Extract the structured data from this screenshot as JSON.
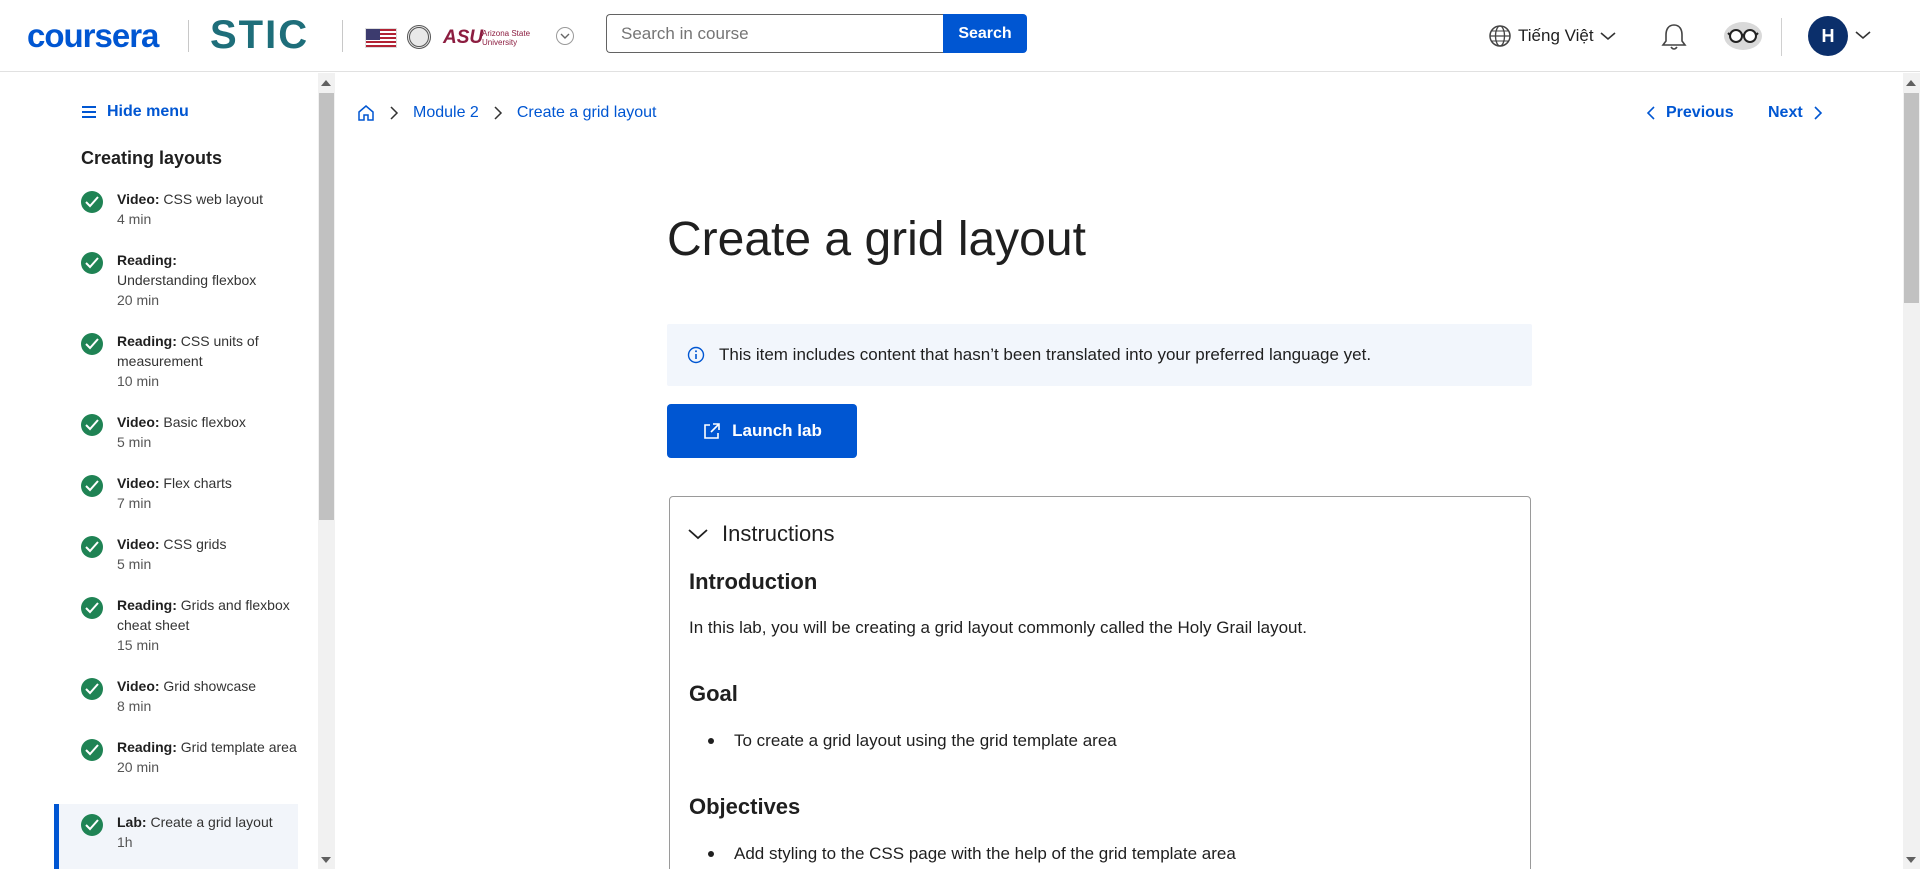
{
  "header": {
    "brand": "coursera",
    "partner": "STIC",
    "asu": "ASU",
    "asu_sub": "Arizona State University",
    "search_placeholder": "Search in course",
    "search_button": "Search",
    "language": "Tiếng Việt",
    "avatar_initial": "H"
  },
  "sidebar": {
    "hide_menu": "Hide menu",
    "section_title": "Creating layouts",
    "items": [
      {
        "kind": "Video:",
        "title": "CSS web layout",
        "duration": "4 min"
      },
      {
        "kind": "Reading:",
        "title": "Understanding flexbox",
        "duration": "20 min"
      },
      {
        "kind": "Reading:",
        "title": "CSS units of measurement",
        "duration": "10 min"
      },
      {
        "kind": "Video:",
        "title": "Basic flexbox",
        "duration": "5 min"
      },
      {
        "kind": "Video:",
        "title": "Flex charts",
        "duration": "7 min"
      },
      {
        "kind": "Video:",
        "title": "CSS grids",
        "duration": "5 min"
      },
      {
        "kind": "Reading:",
        "title": "Grids and flexbox cheat sheet",
        "duration": "15 min"
      },
      {
        "kind": "Video:",
        "title": "Grid showcase",
        "duration": "8 min"
      },
      {
        "kind": "Reading:",
        "title": "Grid template area",
        "duration": "20 min"
      },
      {
        "kind": "Lab:",
        "title": "Create a grid layout",
        "duration": "1h"
      }
    ]
  },
  "breadcrumb": {
    "module": "Module 2",
    "current": "Create a grid layout"
  },
  "nav": {
    "previous": "Previous",
    "next": "Next"
  },
  "main": {
    "title": "Create a grid layout",
    "notice": "This item includes content that hasn’t been translated into your preferred language yet.",
    "launch": "Launch lab",
    "instructions": {
      "heading": "Instructions",
      "intro_heading": "Introduction",
      "intro_text": "In this lab, you will be creating a grid layout commonly called the Holy Grail layout.",
      "goal_heading": "Goal",
      "goal_items": [
        "To create a grid layout  using the grid template area"
      ],
      "objectives_heading": "Objectives",
      "objective_items": [
        "Add styling to the CSS page with the help of the grid template area"
      ]
    }
  }
}
